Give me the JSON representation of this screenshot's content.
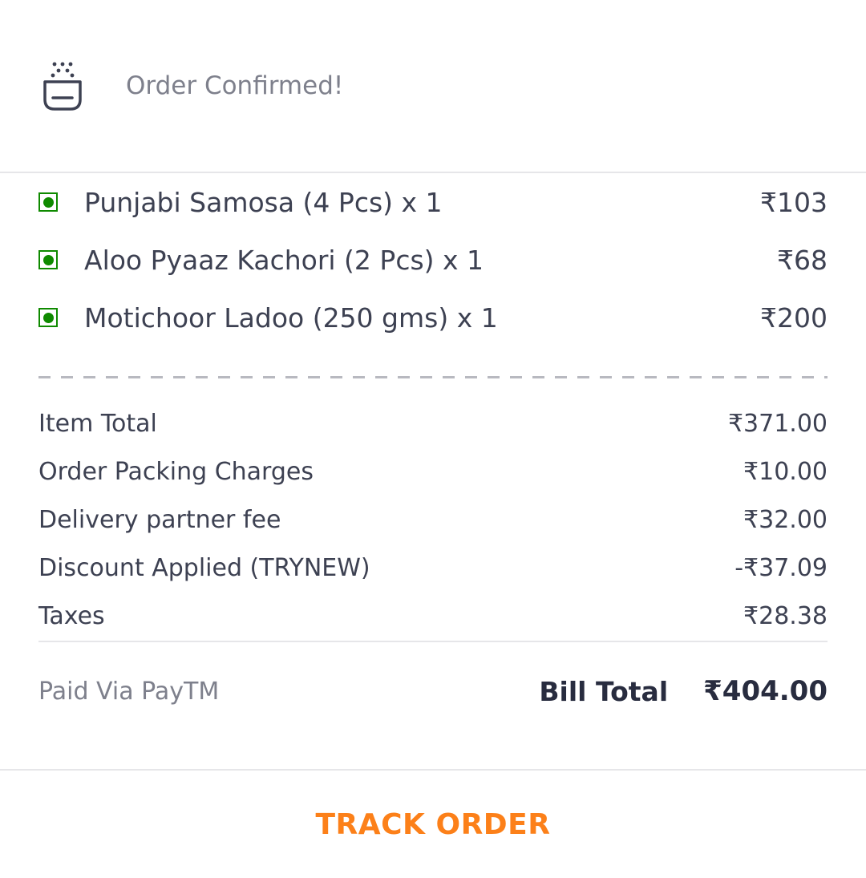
{
  "header": {
    "icon": "bowl-icon",
    "title": "Order Confirmed!"
  },
  "order_items": [
    {
      "name": "Punjabi Samosa (4 Pcs) x 1",
      "price": "₹103",
      "veg": true
    },
    {
      "name": "Aloo Pyaaz Kachori (2 Pcs) x 1",
      "price": "₹68",
      "veg": true
    },
    {
      "name": "Motichoor Ladoo (250 gms) x 1",
      "price": "₹200",
      "veg": true
    }
  ],
  "charges": [
    {
      "label": "Item Total",
      "value": "₹371.00"
    },
    {
      "label": "Order Packing Charges",
      "value": "₹10.00"
    },
    {
      "label": "Delivery partner fee",
      "value": "₹32.00"
    },
    {
      "label": "Discount Applied (TRYNEW)",
      "value": "-₹37.09"
    },
    {
      "label": "Taxes",
      "value": "₹28.38"
    }
  ],
  "bill": {
    "paid_via": "Paid Via PayTM",
    "total_label": "Bill Total",
    "total_value": "₹404.00"
  },
  "footer": {
    "track_label": "TRACK ORDER"
  },
  "colors": {
    "accent": "#fc8019",
    "veg_green": "#0f8a00",
    "text_primary": "#3d4152",
    "text_secondary": "#7e808c"
  }
}
